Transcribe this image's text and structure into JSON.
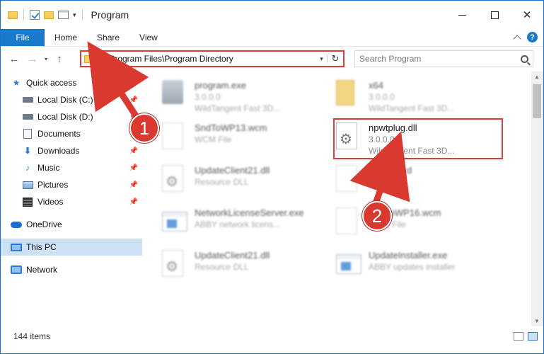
{
  "window": {
    "title": "Program"
  },
  "ribbon": {
    "file_label": "File",
    "tabs": [
      "Home",
      "Share",
      "View"
    ],
    "help_label": "?"
  },
  "nav": {
    "address": "C:\\Program Files\\Program Directory",
    "search_placeholder": "Search Program"
  },
  "sidebar": {
    "items": [
      {
        "label": "Quick access",
        "icon": "star-icon"
      },
      {
        "label": "Local Disk (C:)",
        "icon": "disk-icon"
      },
      {
        "label": "Local Disk (D:)",
        "icon": "disk-icon"
      },
      {
        "label": "Documents",
        "icon": "documents-icon"
      },
      {
        "label": "Downloads",
        "icon": "download-icon"
      },
      {
        "label": "Music",
        "icon": "music-icon"
      },
      {
        "label": "Pictures",
        "icon": "pictures-icon"
      },
      {
        "label": "Videos",
        "icon": "videos-icon"
      },
      {
        "label": "OneDrive",
        "icon": "cloud-icon"
      },
      {
        "label": "This PC",
        "icon": "computer-icon"
      },
      {
        "label": "Network",
        "icon": "network-icon"
      }
    ]
  },
  "files": [
    {
      "name": "program.exe",
      "line2": "3.0.0.0",
      "line3": "WildTangent Fast 3D..."
    },
    {
      "name": "x64",
      "line2": "3.0.0.0",
      "line3": "WildTangent Fast 3D..."
    },
    {
      "name": "SndToWP13.wcm",
      "line2": "WCM File"
    },
    {
      "name": "npwtplug.dll",
      "line2": "3.0.0.0",
      "line3": "WildTangent Fast 3D..."
    },
    {
      "name": "UpdateClient21.dll",
      "line2": "Resource DLL"
    },
    {
      "name": "AnnaWord",
      "line2": "WPF File"
    },
    {
      "name": "NetworkLicenseServer.exe",
      "line2": "ABBY network licens..."
    },
    {
      "name": "SndToWP16.wcm",
      "line2": "WCM File"
    },
    {
      "name": "UpdateClient21.dll",
      "line2": "Resource DLL"
    },
    {
      "name": "UpdateInstaller.exe",
      "line2": "ABBY updates installer"
    }
  ],
  "status": {
    "item_count": "144 items"
  },
  "annotations": {
    "step1": "1",
    "step2": "2",
    "color": "#d9392f"
  }
}
